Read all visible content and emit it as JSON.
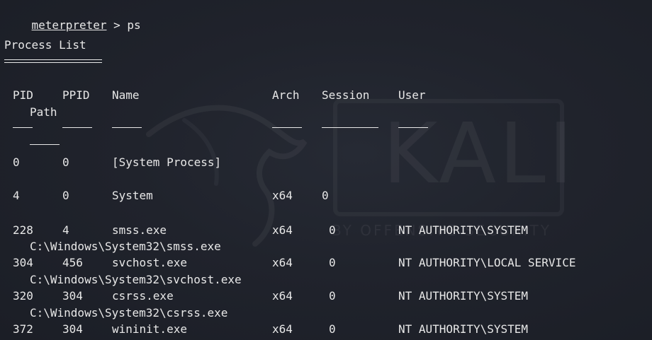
{
  "prompt": {
    "prefix": "meterpreter",
    "separator": " > ",
    "command": "ps"
  },
  "section_title": "Process List",
  "columns": {
    "pid": "PID",
    "ppid": "PPID",
    "name": "Name",
    "arch": "Arch",
    "session": "Session",
    "user": "User",
    "path": "Path"
  },
  "rows": [
    {
      "pid": "0",
      "ppid": "0",
      "name": "[System Process]",
      "arch": "",
      "session": "",
      "user": "",
      "path": ""
    },
    {
      "pid": "4",
      "ppid": "0",
      "name": "System",
      "arch": "x64",
      "session": "0",
      "user": "",
      "path": ""
    },
    {
      "pid": "228",
      "ppid": "4",
      "name": "smss.exe",
      "arch": "x64",
      "session": "0",
      "user": "NT AUTHORITY\\SYSTEM",
      "path": "C:\\Windows\\System32\\smss.exe"
    },
    {
      "pid": "304",
      "ppid": "456",
      "name": "svchost.exe",
      "arch": "x64",
      "session": "0",
      "user": "NT AUTHORITY\\LOCAL SERVICE",
      "path": "C:\\Windows\\System32\\svchost.exe"
    },
    {
      "pid": "320",
      "ppid": "304",
      "name": "csrss.exe",
      "arch": "x64",
      "session": "0",
      "user": "NT AUTHORITY\\SYSTEM",
      "path": "C:\\Windows\\System32\\csrss.exe"
    },
    {
      "pid": "372",
      "ppid": "304",
      "name": "wininit.exe",
      "arch": "x64",
      "session": "0",
      "user": "NT AUTHORITY\\SYSTEM",
      "path": ""
    }
  ],
  "wallpaper": {
    "logo_text": "KALI",
    "tagline": "BY OFFENSIVE SECURITY"
  },
  "colors": {
    "background": "#20232c",
    "text": "#e8e8e8"
  }
}
